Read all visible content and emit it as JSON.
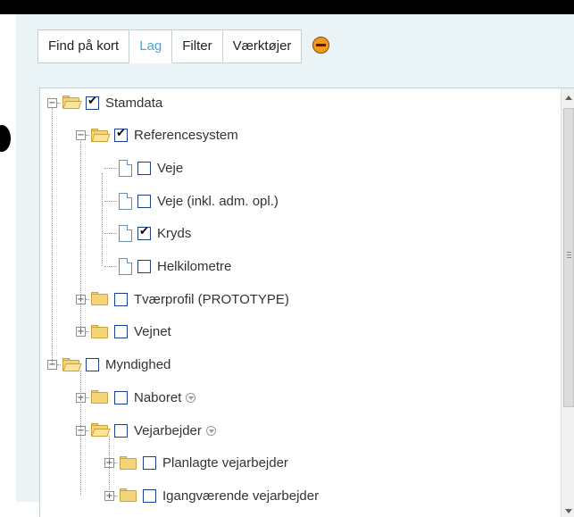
{
  "tabs": [
    {
      "label": "Find på kort",
      "active": false
    },
    {
      "label": "Lag",
      "active": true
    },
    {
      "label": "Filter",
      "active": false
    },
    {
      "label": "Værktøjer",
      "active": false
    }
  ],
  "colors": {
    "active_tab": "#4aa3d8",
    "collapse_button": "#f39a1e"
  },
  "tree": [
    {
      "id": "stamdata",
      "label": "Stamdata",
      "level": 0,
      "type": "folder",
      "open": true,
      "checked": true,
      "info": false
    },
    {
      "id": "referencesystem",
      "label": "Referencesystem",
      "level": 1,
      "type": "folder",
      "open": true,
      "checked": true,
      "info": false
    },
    {
      "id": "veje",
      "label": "Veje",
      "level": 2,
      "type": "leaf",
      "checked": false,
      "info": false
    },
    {
      "id": "veje-inkl",
      "label": "Veje (inkl. adm. opl.)",
      "level": 2,
      "type": "leaf",
      "checked": false,
      "info": false
    },
    {
      "id": "kryds",
      "label": "Kryds",
      "level": 2,
      "type": "leaf",
      "checked": true,
      "info": false
    },
    {
      "id": "helkilometre",
      "label": "Helkilometre",
      "level": 2,
      "type": "leaf",
      "checked": false,
      "info": false
    },
    {
      "id": "tvaerprofil",
      "label": "Tværprofil (PROTOTYPE)",
      "level": 1,
      "type": "folder",
      "open": false,
      "checked": false,
      "info": false
    },
    {
      "id": "vejnet",
      "label": "Vejnet",
      "level": 1,
      "type": "folder",
      "open": false,
      "checked": false,
      "info": false
    },
    {
      "id": "myndighed",
      "label": "Myndighed",
      "level": 0,
      "type": "folder",
      "open": true,
      "checked": false,
      "info": false
    },
    {
      "id": "naboret",
      "label": "Naboret",
      "level": 1,
      "type": "folder",
      "open": false,
      "checked": false,
      "info": true
    },
    {
      "id": "vejarbejder",
      "label": "Vejarbejder",
      "level": 1,
      "type": "folder",
      "open": true,
      "checked": false,
      "info": true
    },
    {
      "id": "planlagte",
      "label": "Planlagte vejarbejder",
      "level": 2,
      "type": "folder",
      "open": false,
      "checked": false,
      "info": false
    },
    {
      "id": "igangvaerende",
      "label": "Igangværende vejarbejder",
      "level": 2,
      "type": "folder",
      "open": false,
      "checked": false,
      "info": false
    }
  ]
}
